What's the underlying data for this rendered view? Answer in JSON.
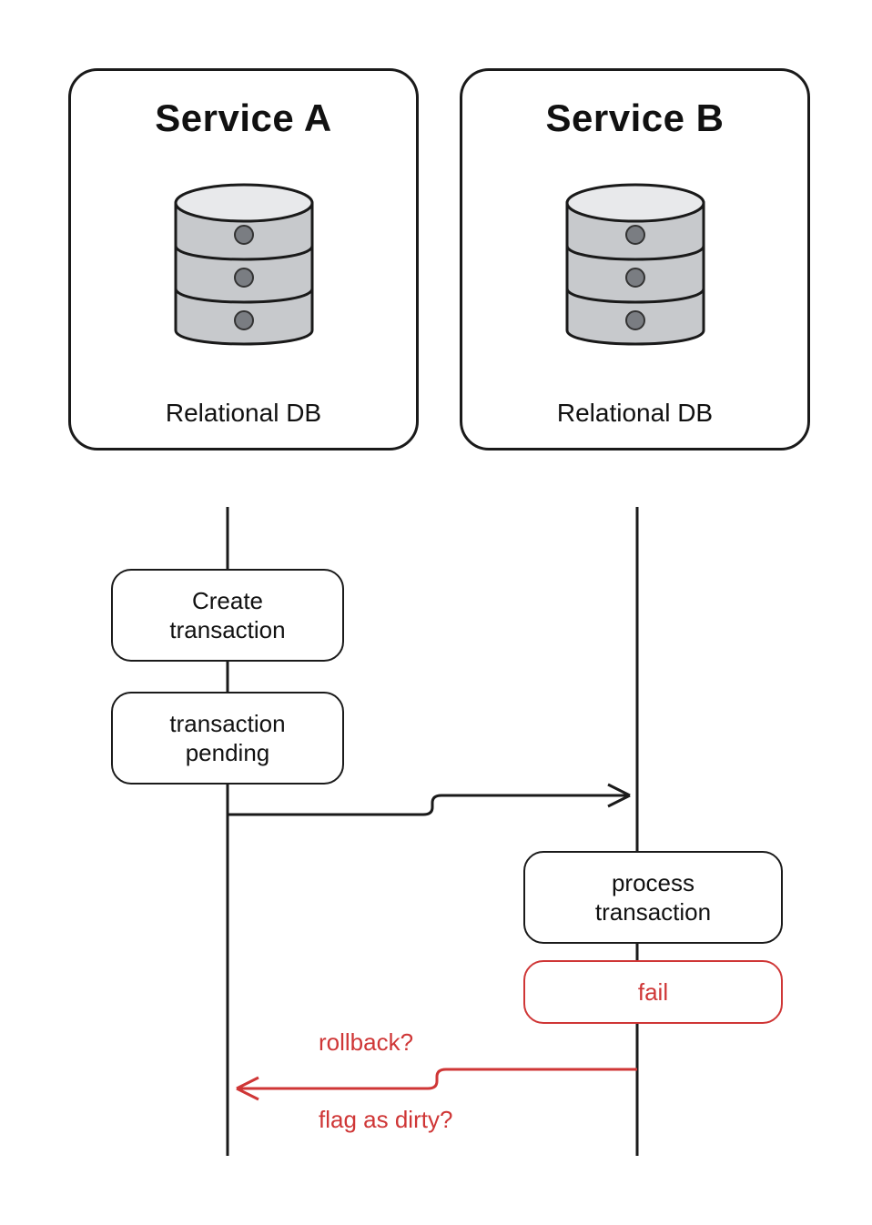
{
  "services": {
    "a": {
      "title": "Service A",
      "db_label": "Relational DB"
    },
    "b": {
      "title": "Service B",
      "db_label": "Relational DB"
    }
  },
  "steps": {
    "create": {
      "line1": "Create",
      "line2": "transaction"
    },
    "pending": {
      "line1": "transaction",
      "line2": "pending"
    },
    "process": {
      "line1": "process",
      "line2": "transaction"
    },
    "fail": {
      "label": "fail"
    }
  },
  "annotations": {
    "rollback": "rollback?",
    "flag_dirty": "flag as dirty?"
  },
  "colors": {
    "ink": "#1a1a1a",
    "error": "#cf3636",
    "db_fill": "#c7c9cc",
    "db_dot": "#7a7d82"
  }
}
